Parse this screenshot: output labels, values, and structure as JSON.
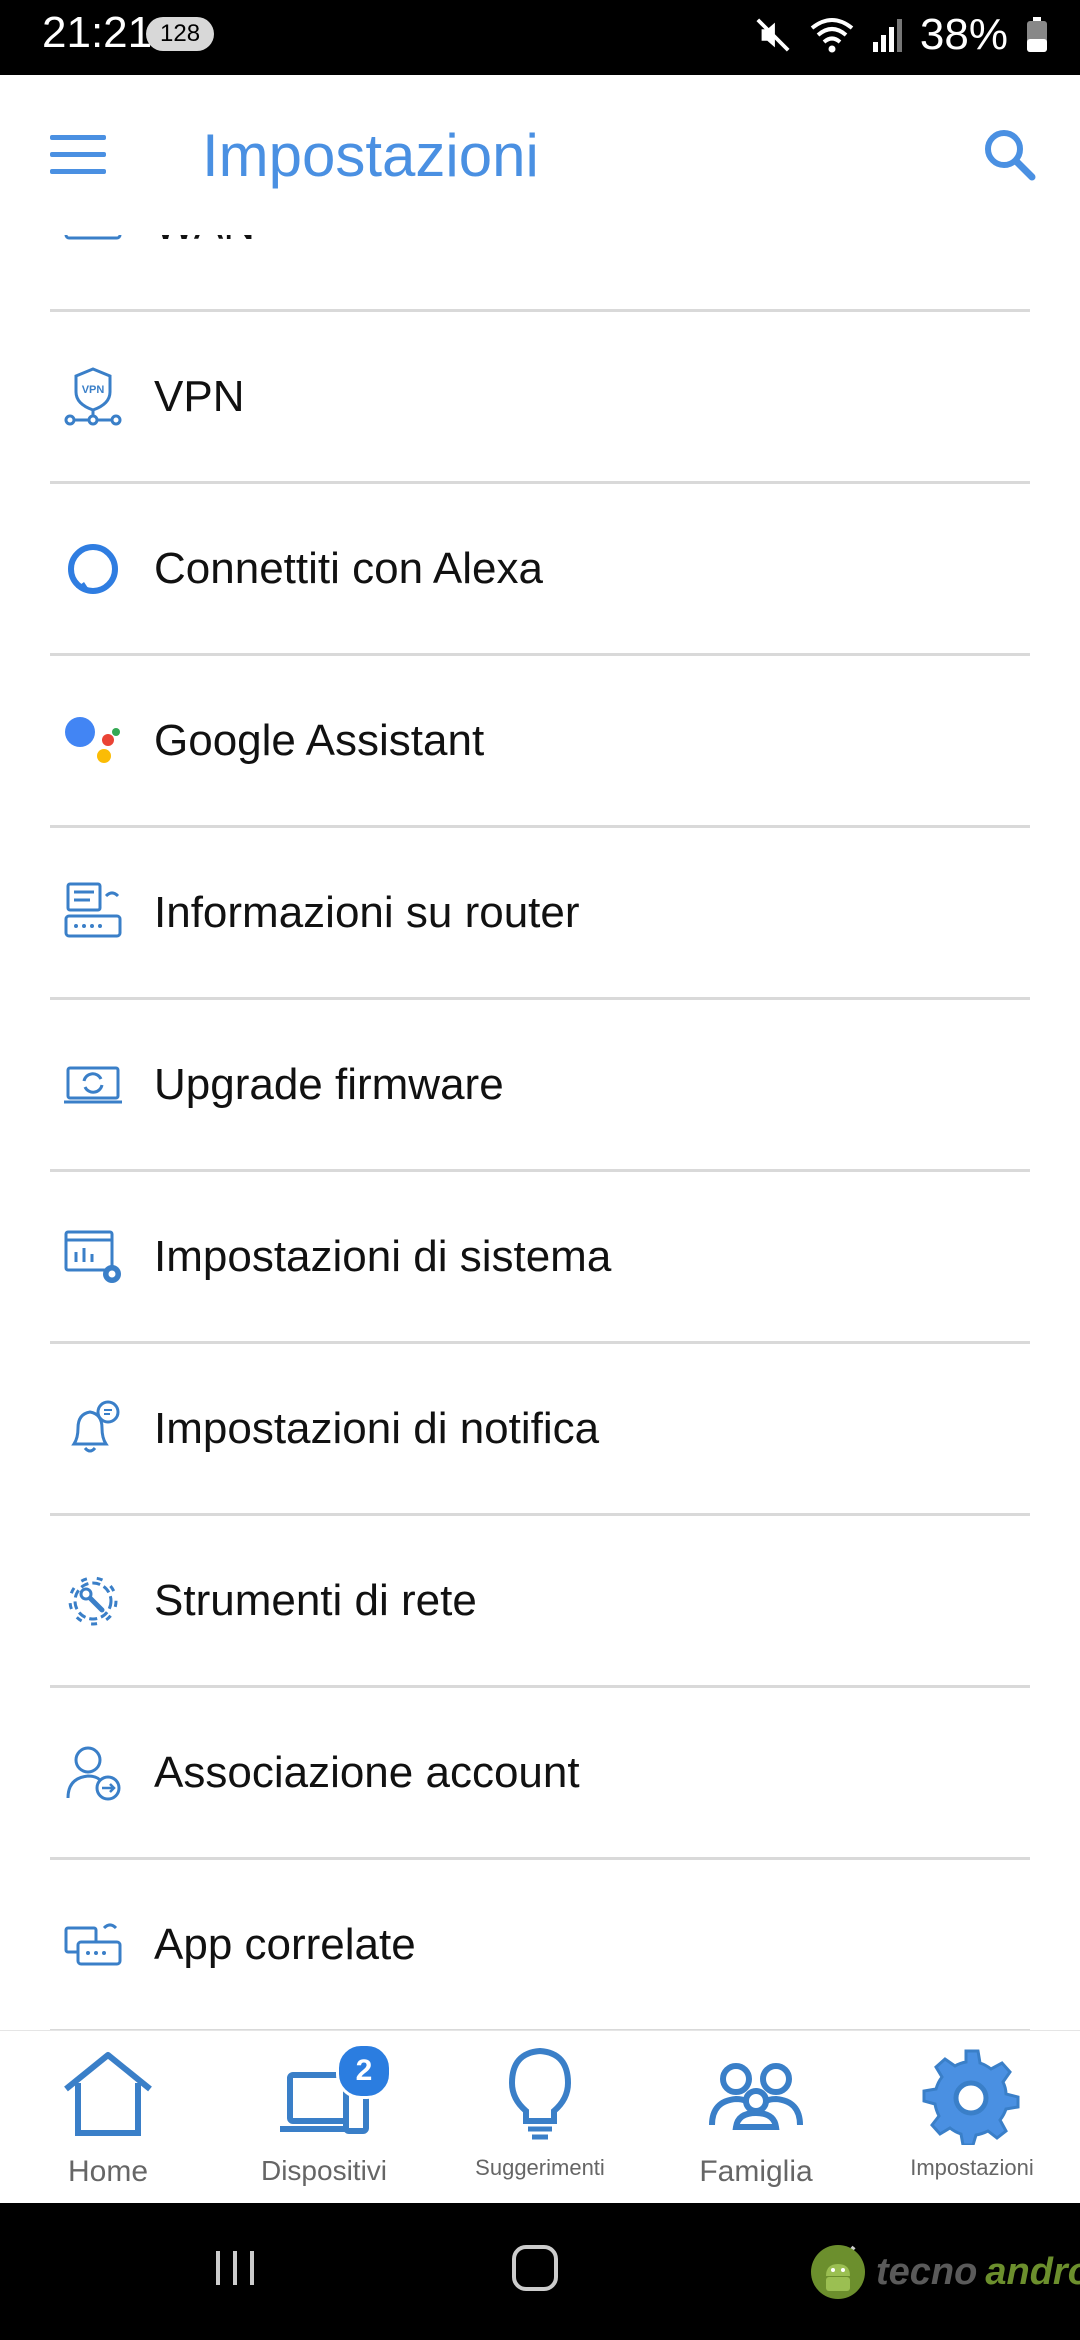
{
  "status_bar": {
    "time": "21:21",
    "notification_count": "128",
    "battery": "38%"
  },
  "app_bar": {
    "title": "Impostazioni"
  },
  "settings_items": [
    {
      "label": "WAN",
      "icon": "wan-icon"
    },
    {
      "label": "VPN",
      "icon": "vpn-icon"
    },
    {
      "label": "Connettiti con Alexa",
      "icon": "alexa-icon"
    },
    {
      "label": "Google Assistant",
      "icon": "google-assistant-icon"
    },
    {
      "label": "Informazioni su router",
      "icon": "router-info-icon"
    },
    {
      "label": "Upgrade firmware",
      "icon": "firmware-icon"
    },
    {
      "label": "Impostazioni di sistema",
      "icon": "system-settings-icon"
    },
    {
      "label": "Impostazioni di notifica",
      "icon": "notification-bell-icon"
    },
    {
      "label": "Strumenti di rete",
      "icon": "network-tools-icon"
    },
    {
      "label": "Associazione account",
      "icon": "account-link-icon"
    },
    {
      "label": "App correlate",
      "icon": "related-apps-icon"
    }
  ],
  "bottom_nav": {
    "tabs": [
      {
        "label": "Home",
        "icon": "home-icon"
      },
      {
        "label": "Dispositivi",
        "icon": "devices-icon",
        "badge": "2"
      },
      {
        "label": "Suggerimenti",
        "icon": "lightbulb-icon"
      },
      {
        "label": "Famiglia",
        "icon": "family-icon"
      },
      {
        "label": "Impostazioni",
        "icon": "gear-icon",
        "active": true
      }
    ]
  },
  "watermark": {
    "part1": "tecno",
    "part2": "android"
  },
  "colors": {
    "accent": "#4a90e2",
    "icon": "#3a7fc8",
    "divider": "#d9d9d9",
    "badge": "#2b7de0"
  }
}
